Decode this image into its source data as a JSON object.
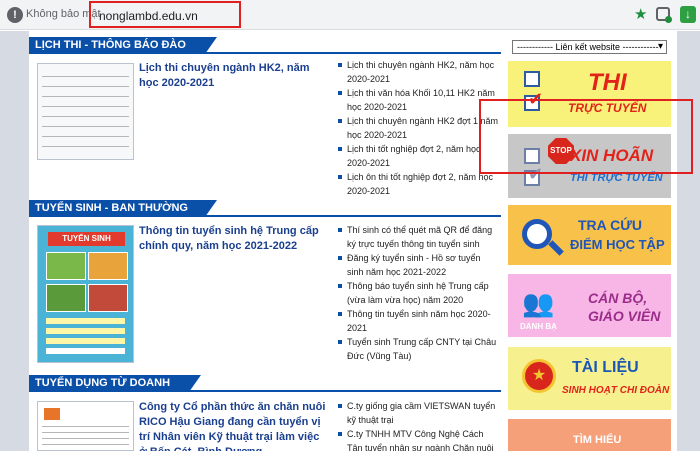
{
  "browser": {
    "insecure_label": "Không bảo mật",
    "url": "nonglambd.edu.vn"
  },
  "sections": {
    "exam": {
      "title": "LỊCH THI - THÔNG BÁO ĐÀO TẠO",
      "headline": "Lịch thi chuyên ngành HK2, năm học 2020-2021",
      "related": [
        "Lịch thi chuyên ngành HK2, năm học 2020-2021",
        "Lịch thi văn hóa Khối 10,11 HK2 năm học 2020-2021",
        "Lịch thi chuyên ngành HK2 đợt 1 năm học 2020-2021",
        "Lịch thi tốt nghiệp đợt 2, năm học 2020-2021",
        "Lịch ôn thi tốt nghiệp đợt 2, năm học 2020-2021"
      ]
    },
    "admission": {
      "title": "TUYỂN SINH - BAN THƯỜNG XUYÊN",
      "headline": "Thông tin tuyển sinh hệ Trung cấp chính quy, năm học 2021-2022",
      "poster_title": "TUYỂN SINH",
      "related": [
        "Thí sinh có thể quét mã QR để đăng ký trực tuyến thông tin tuyển sinh",
        "Đăng ký tuyển sinh - Hồ sơ tuyển sinh năm học 2021-2022",
        "Thông báo tuyển sinh hệ Trung cấp (vừa làm vừa học) năm 2020",
        "Thông tin tuyển sinh năm học 2020-2021",
        "Tuyển sinh Trung cấp CNTY tại Châu Đức (Vũng Tàu)"
      ]
    },
    "recruit": {
      "title": "TUYỂN DỤNG TỪ DOANH NGHIỆP",
      "headline": "Công ty Cổ phần thức ăn chăn nuôi RICO Hậu Giang đang cần tuyển vị trí Nhân viên Kỹ thuật trại làm việc ở Bến Cát, Bình Dương",
      "related": [
        "C.ty giống gia cầm VIETSWAN tuyển kỹ thuật trại",
        "C.ty TNHH MTV Công Nghệ Cách Tân tuyển nhân sự ngành Chăn nuôi Thú y"
      ]
    }
  },
  "sidebar": {
    "links_select": "------------ Liên kết website ------------",
    "banners": {
      "thi_big": "THI",
      "thi_small": "TRỰC TUYẾN",
      "stop": "STOP",
      "xin_big": "XIN HOÃN",
      "xin_small": "THI TRỰC TUYẾN",
      "tra_big": "TRA CỨU",
      "tra_small": "ĐIỂM HỌC TẬP",
      "can_big": "CÁN BỘ,",
      "can_small": "GIÁO VIÊN",
      "can_cap": "DANH BẠ",
      "tai_big": "TÀI LIỆU",
      "tai_small": "SINH HOẠT CHI ĐOÀN",
      "tim_big": "TÌM HIỂU"
    }
  },
  "colors": {
    "accent": "#0a4fa8",
    "highlight": "#e02020"
  }
}
